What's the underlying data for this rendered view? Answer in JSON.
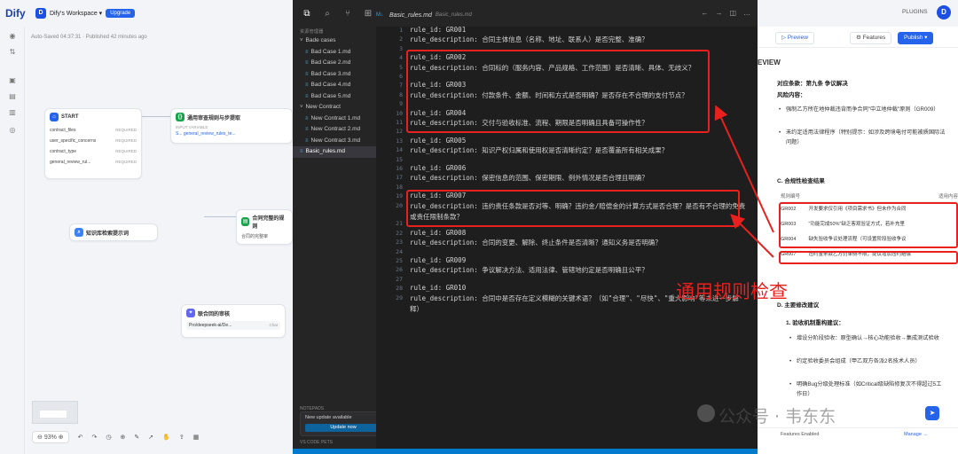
{
  "dify": {
    "logo": "Dify",
    "workspace_initial": "D",
    "workspace_name": "Dify's Workspace ▾",
    "upgrade": "Upgrade",
    "autosave": "Auto-Saved 04:37:31 · Published 42 minutes ago",
    "start_node": {
      "title": "START",
      "rows": [
        {
          "name": "contract_files",
          "tag": "REQUIRED"
        },
        {
          "name": "user_specific_concerns",
          "tag": "REQUIRED"
        },
        {
          "name": "contract_type",
          "tag": "REQUIRED"
        },
        {
          "name": "general_review_rul...",
          "tag": "REQUIRED"
        }
      ]
    },
    "rules_node": {
      "title": "通用审查规则与步提取",
      "sub": "INPUT VARIABLE",
      "var": "S... general_review_rules_te..."
    },
    "kb_node": {
      "title": "知识库检索提示词"
    },
    "upload_node": {
      "title": "合同完整的规则",
      "sub": "合同的完整审"
    },
    "llm_node": {
      "title": "联合回的审核",
      "model": "Pro/deepseek-ai/De...",
      "tag": "Chat"
    },
    "zoom": "93%"
  },
  "vscode": {
    "tab_name": "Basic_rules.md",
    "tab_path": "Basic_rules.md",
    "side_header": "资源管理器",
    "tree": [
      {
        "label": "Bade cases",
        "type": "folder"
      },
      {
        "label": "Bad Case 1.md",
        "type": "file"
      },
      {
        "label": "Bad Case 2.md",
        "type": "file"
      },
      {
        "label": "Bad Case 3.md",
        "type": "file"
      },
      {
        "label": "Bad Case 4.md",
        "type": "file"
      },
      {
        "label": "Bad Case 5.md",
        "type": "file"
      },
      {
        "label": "New Contract",
        "type": "folder"
      },
      {
        "label": "New Contract 1.md",
        "type": "file"
      },
      {
        "label": "New Contract 2.md",
        "type": "file"
      },
      {
        "label": "New Contract 3.md",
        "type": "file"
      },
      {
        "label": "Basic_rules.md",
        "type": "file"
      }
    ],
    "notepads": "NOTEPADS",
    "code_pets": "VS CODE PETS",
    "notif_text": "New update available",
    "notif_btn": "Update now",
    "lines": [
      {
        "n": "1",
        "t": "rule_id: GR001"
      },
      {
        "n": "2",
        "t": "rule_description: 合同主体信息（名称、地址、联系人）是否完整、准确？"
      },
      {
        "n": "3",
        "t": ""
      },
      {
        "n": "4",
        "t": "rule_id: GR002"
      },
      {
        "n": "5",
        "t": "rule_description: 合同标的（服务内容、产品规格、工作范围）是否清晰、具体、无歧义？"
      },
      {
        "n": "6",
        "t": ""
      },
      {
        "n": "7",
        "t": "rule_id: GR003"
      },
      {
        "n": "8",
        "t": "rule_description: 付款条件、金额、时间和方式是否明确？是否存在不合理的支付节点？"
      },
      {
        "n": "9",
        "t": ""
      },
      {
        "n": "10",
        "t": "rule_id: GR004"
      },
      {
        "n": "11",
        "t": "rule_description: 交付与验收标准、流程、期限是否明确且具备可操作性？"
      },
      {
        "n": "12",
        "t": ""
      },
      {
        "n": "13",
        "t": "rule_id: GR005"
      },
      {
        "n": "14",
        "t": "rule_description: 知识产权归属和使用权是否清晰约定？是否覆盖所有相关成果？"
      },
      {
        "n": "15",
        "t": ""
      },
      {
        "n": "16",
        "t": "rule_id: GR006"
      },
      {
        "n": "17",
        "t": "rule_description: 保密信息的范围、保密期限、例外情况是否合理且明确？"
      },
      {
        "n": "18",
        "t": ""
      },
      {
        "n": "19",
        "t": "rule_id: GR007"
      },
      {
        "n": "20",
        "t": "rule_description: 违约责任条款是否对等、明确？违约金/赔偿金的计算方式是否合理？是否有不合理的免责或责任限制条款？"
      },
      {
        "n": "21",
        "t": ""
      },
      {
        "n": "22",
        "t": "rule_id: GR008"
      },
      {
        "n": "23",
        "t": "rule_description: 合同的变更、解除、终止条件是否清晰？通知义务是否明确？"
      },
      {
        "n": "24",
        "t": ""
      },
      {
        "n": "25",
        "t": "rule_id: GR009"
      },
      {
        "n": "26",
        "t": "rule_description: 争议解决方法、适用法律、管辖地约定是否明确且公平？"
      },
      {
        "n": "27",
        "t": ""
      },
      {
        "n": "28",
        "t": "rule_id: GR010"
      },
      {
        "n": "29",
        "t": "rule_description: 合同中是否存在定义模糊的关键术语？（如\"合理\"、\"尽快\"、\"重大影响\"等未进一步解释）"
      }
    ]
  },
  "review": {
    "plugins": "PLUGINS",
    "avatar": "D",
    "preview": "Preview",
    "features": "Features",
    "publish": "Publish ▾",
    "title": "EVIEW",
    "clause": "对应条款：第九条 争议解决",
    "risk": "风险内容：",
    "bullets": [
      "强制乙方所在地仲裁违背而争合同\"中立地仲裁\"原则（GR009）",
      "未约定适用法律程序（特别提示：如涉及跨境电付可能被质国际法问题）"
    ],
    "section_c": "C. 合规性检查结果",
    "table_head": [
      "规则编号",
      "适用内容"
    ],
    "table_rows": [
      [
        "GR002",
        "开发要求仅引用《项目需求书》但未作为合同"
      ],
      [
        "GR003",
        "\"功能完成50%\"缺乏客观验证方式，若补充里"
      ],
      [
        "GR004",
        "缺失验收争议处理流程（可设置阶段验收争议"
      ],
      [
        "GR007",
        "违约金条款乙方仍单侧不限，提议增加违约赔偿"
      ]
    ],
    "section_d": "D. 主要修改建议",
    "sub_1": "1. 验收机制重构建议：",
    "sub_bullets": [
      "增设分阶段验收：原型确认→核心功能验收→集成测试验收",
      "约定验收委员会组成（甲乙双方各派2名技术人员）",
      "明确Bug分级处理标准（如Critical级缺陷修复次不得超过5工作日）"
    ],
    "features_enabled": "Features Enabled",
    "manage": "Manage →"
  },
  "overlay": {
    "label": "通用规则检查",
    "watermark": "公众号 · 韦东东"
  }
}
